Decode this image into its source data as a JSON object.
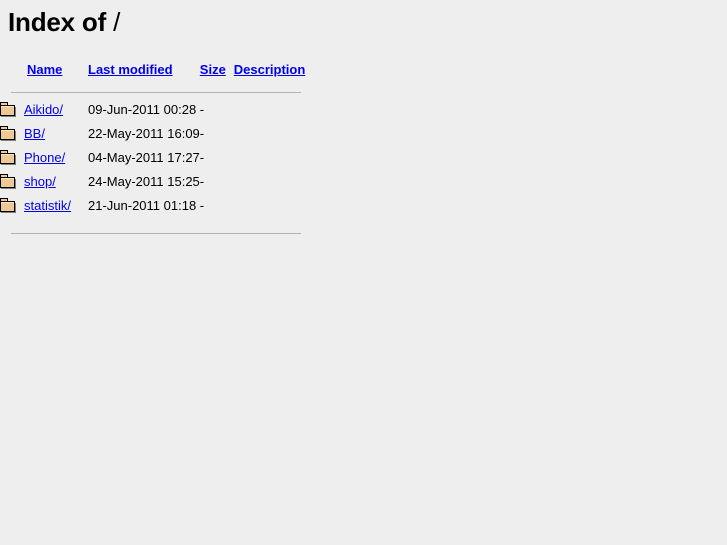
{
  "page": {
    "title_prefix": "Index of",
    "path": "/",
    "background_color": "#eeeeee",
    "link_color": "#0000ee",
    "text_color": "#000000",
    "rule_color": "#b4b4b4",
    "folder_icon_color": "#f0c894"
  },
  "table": {
    "columns": [
      {
        "key": "icon",
        "label": ""
      },
      {
        "key": "name",
        "label": "Name"
      },
      {
        "key": "date",
        "label": "Last modified"
      },
      {
        "key": "size",
        "label": "Size"
      },
      {
        "key": "desc",
        "label": "Description"
      }
    ],
    "headers": {
      "icon": "",
      "name": "Name",
      "date": "Last modified",
      "size": "Size",
      "desc": "Description"
    },
    "rows": [
      {
        "icon": "folder-icon",
        "name": "Aikido/",
        "date": "09-Jun-2011 00:28",
        "size": "-",
        "desc": ""
      },
      {
        "icon": "folder-icon",
        "name": "BB/",
        "date": "22-May-2011 16:09",
        "size": "-",
        "desc": ""
      },
      {
        "icon": "folder-icon",
        "name": "Phone/",
        "date": "04-May-2011 17:27",
        "size": "-",
        "desc": ""
      },
      {
        "icon": "folder-icon",
        "name": "shop/",
        "date": "24-May-2011 15:25",
        "size": "-",
        "desc": ""
      },
      {
        "icon": "folder-icon",
        "name": "statistik/",
        "date": "21-Jun-2011 01:18",
        "size": "-",
        "desc": ""
      }
    ]
  }
}
